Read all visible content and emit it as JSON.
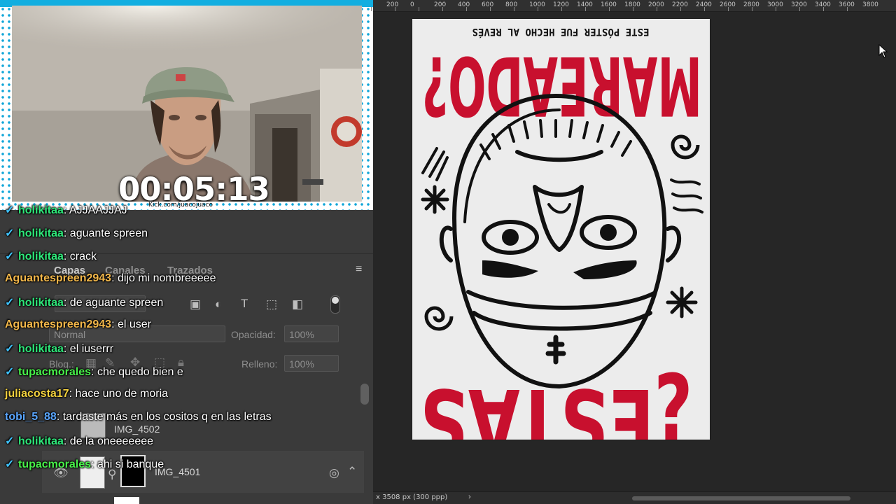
{
  "webcam": {
    "timer": "00:05:13",
    "watermark": "Kick.com/juacojuaco"
  },
  "photoshop_panel": {
    "tabs": [
      "Capas",
      "Canales",
      "Trazados"
    ],
    "blend_mode": "Normal",
    "opacity_label": "Opacidad:",
    "opacity_value": "100%",
    "lock_label": "Bloq.:",
    "fill_label": "Relleno:",
    "fill_value": "100%",
    "layers": [
      "IMG_4502",
      "IMG_4501"
    ]
  },
  "chat": [
    {
      "user": "holikitaa",
      "message": "AJJAAJJAJ",
      "badge": true,
      "color": "#2ee87a"
    },
    {
      "user": "holikitaa",
      "message": "aguante spreen",
      "badge": true,
      "color": "#2ee87a"
    },
    {
      "user": "holikitaa",
      "message": "crack",
      "badge": true,
      "color": "#2ee87a"
    },
    {
      "user": "Aguantespreen2943",
      "message": "dijo mi nombreeeee",
      "badge": false,
      "color": "#f2b74a"
    },
    {
      "user": "holikitaa",
      "message": "de aguante spreen",
      "badge": true,
      "color": "#2ee87a"
    },
    {
      "user": "Aguantespreen2943",
      "message": "el user",
      "badge": false,
      "color": "#f2b74a"
    },
    {
      "user": "holikitaa",
      "message": "el iuserrr",
      "badge": true,
      "color": "#2ee87a"
    },
    {
      "user": "tupacmorales",
      "message": "che quedo bien e",
      "badge": true,
      "color": "#48f24a"
    },
    {
      "user": "juliacosta17",
      "message": "hace uno de moria",
      "badge": false,
      "color": "#f4d23e"
    },
    {
      "user": "tobi_5_88",
      "message": "tardaste más en los cositos q en las letras",
      "badge": false,
      "color": "#5aa6ff"
    },
    {
      "user": "holikitaa",
      "message": "de la oneeeeeee",
      "badge": true,
      "color": "#2ee87a"
    },
    {
      "user": "tupacmorales",
      "message": "ahi si banque",
      "badge": true,
      "color": "#48f24a"
    }
  ],
  "ruler": {
    "labels": [
      "200",
      "0",
      "200",
      "400",
      "600",
      "800",
      "1000",
      "1200",
      "1400",
      "1600",
      "1800",
      "2000",
      "2200",
      "2400",
      "2600",
      "2800",
      "3000",
      "3200",
      "3400",
      "3600",
      "3800"
    ]
  },
  "poster": {
    "top_text": "ESTE PÓSTER FUE HECHO AL REVÉS",
    "headline_top": "MAREADO?",
    "headline_bottom": "¿ESTÁS",
    "ink_color": "#111111",
    "accent_color": "#c8102e"
  },
  "status_bar": {
    "text": "x 3508 px (300 ppp)",
    "chevron": "›"
  }
}
